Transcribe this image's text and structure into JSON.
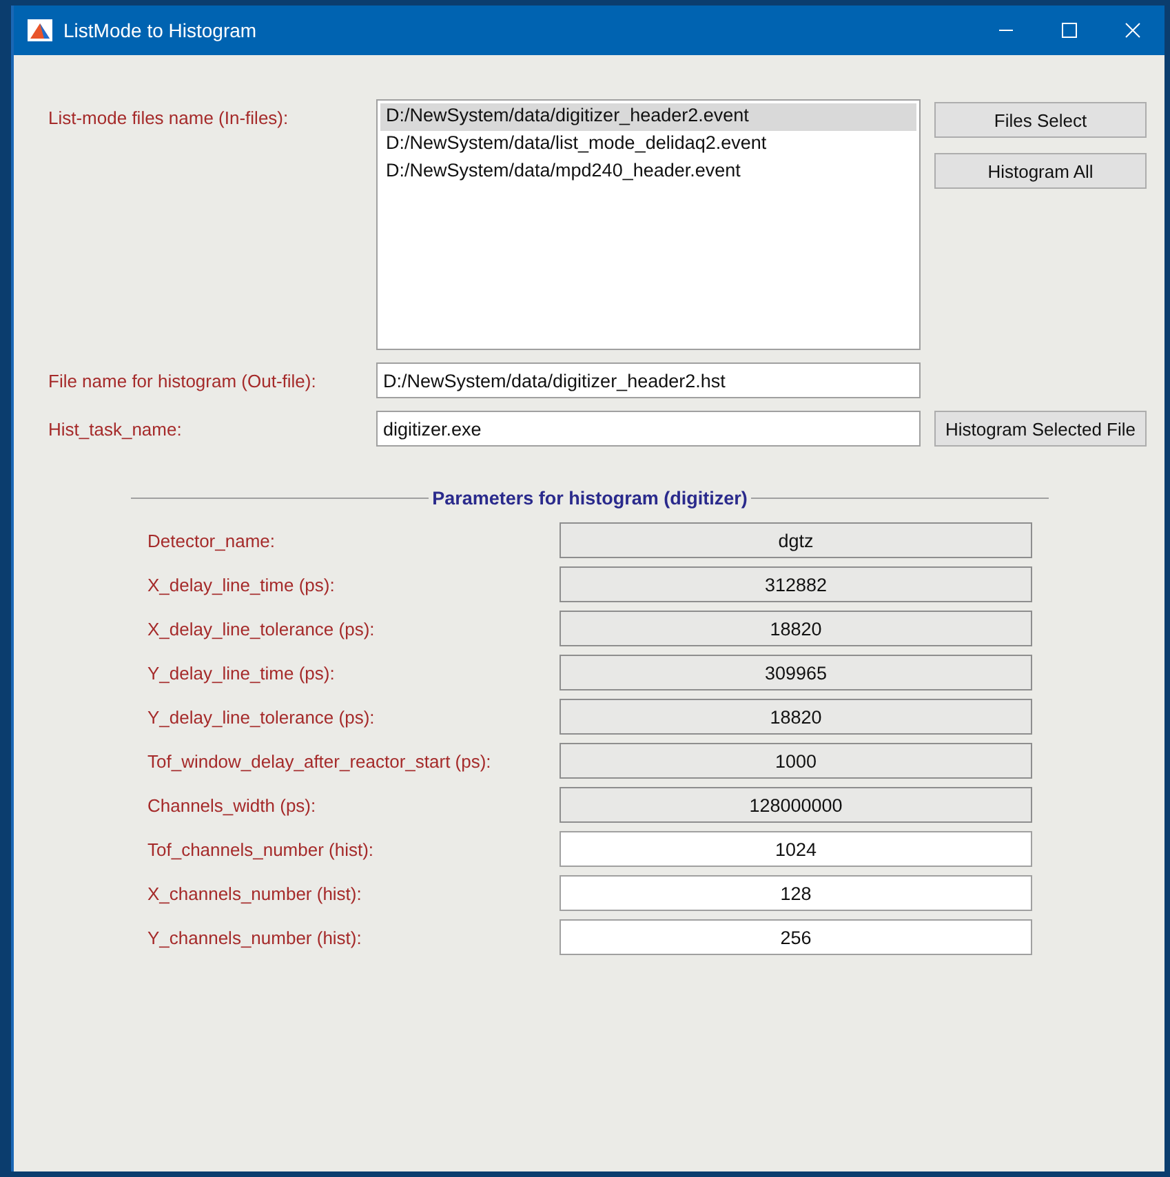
{
  "window": {
    "title": "ListMode to Histogram"
  },
  "in_files": {
    "label": "List-mode files name (In-files):",
    "files": [
      {
        "name": "D:/NewSystem/data/digitizer_header2.event",
        "selected": true
      },
      {
        "name": "D:/NewSystem/data/list_mode_delidaq2.event",
        "selected": false
      },
      {
        "name": "D:/NewSystem/data/mpd240_header.event",
        "selected": false
      }
    ]
  },
  "buttons": [
    "Files Select",
    "Histogram All"
  ],
  "out_file": {
    "label": "File name for histogram (Out-file):",
    "value": "D:/NewSystem/data/digitizer_header2.hst"
  },
  "hist_task": {
    "label": "Hist_task_name:",
    "value": "digitizer.exe",
    "button": "Histogram Selected File"
  },
  "parameters": {
    "title": "Parameters for histogram (digitizer)",
    "rows": [
      {
        "label": "Detector_name:",
        "value": "dgtz",
        "editable": false
      },
      {
        "label": "X_delay_line_time (ps):",
        "value": "312882",
        "editable": false
      },
      {
        "label": "X_delay_line_tolerance (ps):",
        "value": "18820",
        "editable": false
      },
      {
        "label": "Y_delay_line_time (ps):",
        "value": "309965",
        "editable": false
      },
      {
        "label": "Y_delay_line_tolerance (ps):",
        "value": "18820",
        "editable": false
      },
      {
        "label": "Tof_window_delay_after_reactor_start (ps):",
        "value": "1000",
        "editable": false
      },
      {
        "label": "Channels_width (ps):",
        "value": "128000000",
        "editable": false
      },
      {
        "label": "Tof_channels_number (hist):",
        "value": "1024",
        "editable": true
      },
      {
        "label": "X_channels_number (hist):",
        "value": "128",
        "editable": true
      },
      {
        "label": "Y_channels_number (hist):",
        "value": "256",
        "editable": true
      }
    ]
  }
}
